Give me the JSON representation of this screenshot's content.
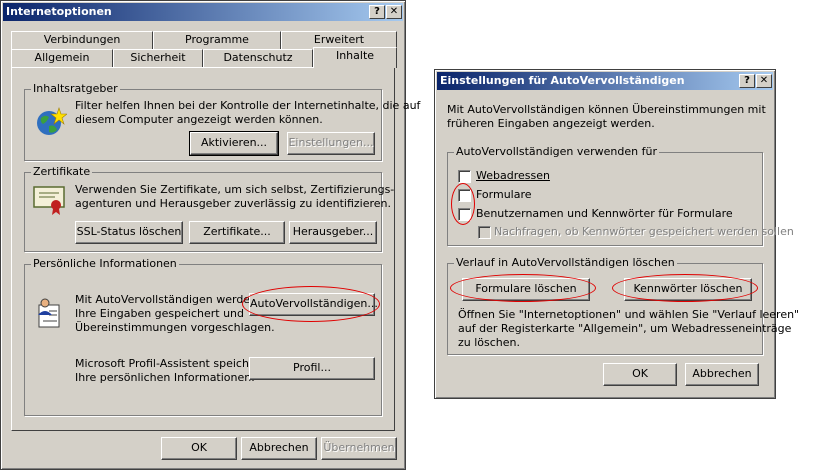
{
  "main_window": {
    "title": "Internetoptionen",
    "help_btn": "?",
    "close_btn": "✕",
    "tabs_row1": [
      "Verbindungen",
      "Programme",
      "Erweitert"
    ],
    "tabs_row2": [
      "Allgemein",
      "Sicherheit",
      "Datenschutz",
      "Inhalte"
    ],
    "content_advisor": {
      "legend": "Inhaltsratgeber",
      "text1": "Filter helfen Ihnen bei der Kontrolle der Internetinhalte, die auf",
      "text2": "diesem Computer angezeigt werden können.",
      "enable_btn": "Aktivieren...",
      "settings_btn": "Einstellungen..."
    },
    "certificates": {
      "legend": "Zertifikate",
      "text1": "Verwenden Sie Zertifikate, um sich selbst, Zertifizierungs-",
      "text2": "agenturen und Herausgeber zuverlässig zu identifizieren.",
      "ssl_btn": "SSL-Status löschen",
      "certs_btn": "Zertifikate...",
      "publishers_btn": "Herausgeber..."
    },
    "personal": {
      "legend": "Persönliche Informationen",
      "auto_text1": "Mit AutoVervollständigen werden",
      "auto_text2": "Ihre Eingaben gespeichert und",
      "auto_text3": "Übereinstimmungen vorgeschlagen.",
      "autocomplete_btn": "AutoVervollständigen...",
      "profile_text1": "Microsoft Profil-Assistent speichert",
      "profile_text2": "Ihre persönlichen Informationen.",
      "profile_btn": "Profil..."
    },
    "ok_btn": "OK",
    "cancel_btn": "Abbrechen",
    "apply_btn": "Übernehmen"
  },
  "dialog": {
    "title": "Einstellungen für AutoVervollständigen",
    "help_btn": "?",
    "close_btn": "✕",
    "intro1": "Mit AutoVervollständigen können Übereinstimmungen mit",
    "intro2": "früheren Eingaben angezeigt werden.",
    "use_group": {
      "legend": "AutoVervollständigen verwenden für",
      "webaddresses": "Webadressen",
      "forms": "Formulare",
      "usernames": "Benutzernamen und Kennwörter für Formulare",
      "prompt": "Nachfragen, ob Kennwörter gespeichert werden sollen"
    },
    "history_group": {
      "legend": "Verlauf in AutoVervollständigen löschen",
      "clear_forms_btn": "Formulare löschen",
      "clear_passwords_btn": "Kennwörter löschen",
      "note1": "Öffnen Sie \"Internetoptionen\" und wählen Sie \"Verlauf leeren\"",
      "note2": "auf der Registerkarte \"Allgemein\", um Webadresseneinträge",
      "note3": "zu löschen."
    },
    "ok_btn": "OK",
    "cancel_btn": "Abbrechen"
  },
  "colors": {
    "titlebar_start": "#0a246a",
    "titlebar_end": "#a6caf0",
    "highlight_ellipse": "#e00000",
    "face": "#d4d0c8"
  }
}
